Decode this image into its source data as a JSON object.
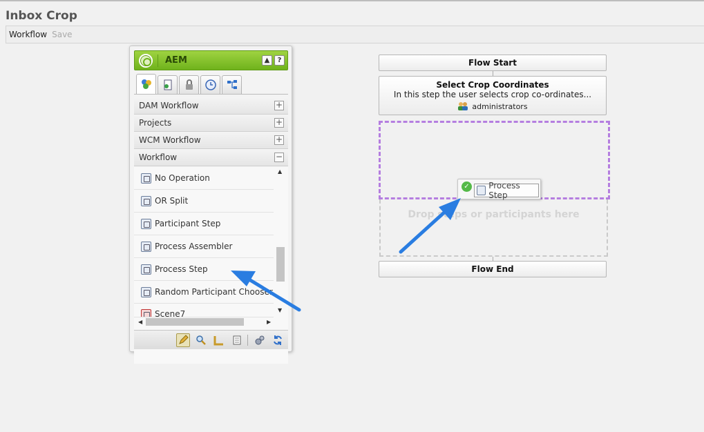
{
  "page": {
    "title": "Inbox Crop"
  },
  "toolbar": {
    "title": "Workflow",
    "save_label": "Save"
  },
  "sidekick": {
    "title": "AEM",
    "header_buttons": [
      "▲",
      "?"
    ],
    "tabs": [
      "components-tab",
      "pages-tab",
      "lock-tab",
      "versions-tab",
      "workflow-tab"
    ],
    "groups": [
      {
        "label": "DAM Workflow",
        "toggle": "+"
      },
      {
        "label": "Projects",
        "toggle": "+"
      },
      {
        "label": "WCM Workflow",
        "toggle": "+"
      },
      {
        "label": "Workflow",
        "toggle": "−"
      }
    ],
    "items": [
      {
        "label": "No Operation",
        "icon": "process-icon"
      },
      {
        "label": "OR Split",
        "icon": "split-icon"
      },
      {
        "label": "Participant Step",
        "icon": "participant-icon"
      },
      {
        "label": "Process Assembler",
        "icon": "process-icon"
      },
      {
        "label": "Process Step",
        "icon": "process-icon"
      },
      {
        "label": "Random Participant Chooser",
        "icon": "participant-icon"
      },
      {
        "label": "Scene7",
        "icon": "scene7-icon"
      }
    ],
    "footer_icons": [
      "edit-icon",
      "preview-icon",
      "design-icon",
      "scaffolding-icon",
      "settings-icon",
      "refresh-icon"
    ]
  },
  "flow": {
    "start_label": "Flow Start",
    "step": {
      "title": "Select Crop Coordinates",
      "description": "In this step the user selects crop co-ordinates...",
      "assignee": "administrators"
    },
    "drop_placeholder": "Drop steps or participants here",
    "end_label": "Flow End",
    "dragging_label": "Process Step"
  },
  "colors": {
    "sidekick_header": "#7fbf26",
    "drop_zone": "#b57ee0",
    "callout_arrow": "#2a7de1"
  }
}
